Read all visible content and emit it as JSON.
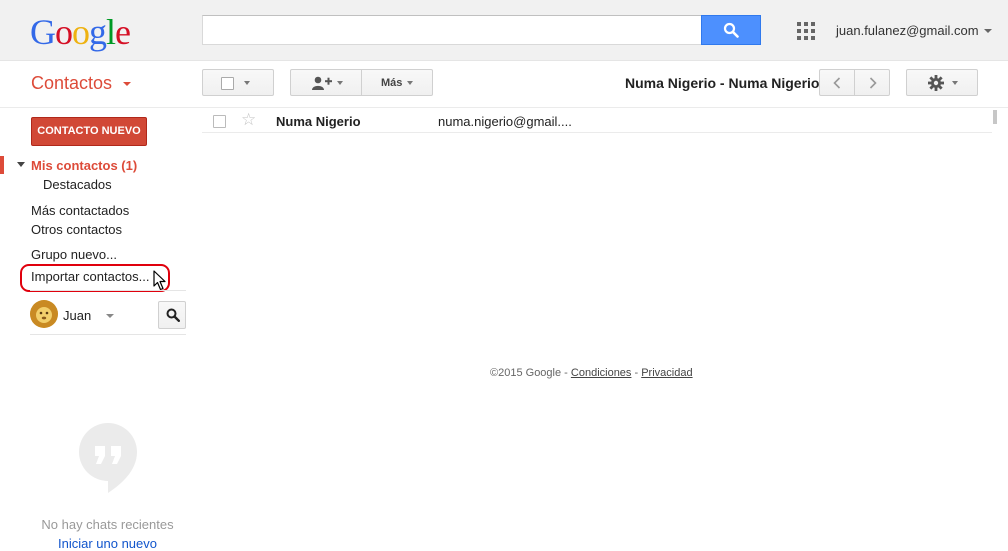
{
  "header": {
    "logo_letters": [
      {
        "ch": "G",
        "color": "#3369e8"
      },
      {
        "ch": "o",
        "color": "#d50f25"
      },
      {
        "ch": "o",
        "color": "#eeb211"
      },
      {
        "ch": "g",
        "color": "#3369e8"
      },
      {
        "ch": "l",
        "color": "#009925"
      },
      {
        "ch": "e",
        "color": "#d50f25"
      }
    ],
    "search_value": "",
    "search_icon": "search-icon",
    "apps_icon": "apps-grid-icon",
    "account_email": "juan.fulanez@gmail.com"
  },
  "toolbar": {
    "app_title": "Contactos",
    "more_label": "Más",
    "page_title": "Numa Nigerio - Numa Nigerio",
    "add_to_group_icon": "add-person-icon",
    "prev_icon": "chevron-left-icon",
    "next_icon": "chevron-right-icon",
    "settings_icon": "gear-icon"
  },
  "sidebar": {
    "new_contact_label": "CONTACTO NUEVO",
    "my_contacts": "Mis contactos (1)",
    "starred": "Destacados",
    "most_contacted": "Más contactados",
    "other_contacts": "Otros contactos",
    "new_group": "Grupo nuevo...",
    "import_contacts": "Importar contactos..."
  },
  "chat": {
    "user_name": "Juan",
    "no_chats": "No hay chats recientes",
    "start_chat": "Iniciar uno nuevo",
    "hangouts_icon": "hangouts-quote-icon"
  },
  "contacts": [
    {
      "name": "Numa Nigerio",
      "email": "numa.nigerio@gmail....",
      "starred": false
    }
  ],
  "footer": {
    "copyright": "©2015 Google",
    "separator": " - ",
    "terms": "Condiciones",
    "privacy": "Privacidad"
  },
  "colors": {
    "accent_red": "#dd4b39",
    "button_red": "#d14836",
    "blue_button": "#4d90fe",
    "link_blue": "#1155cc",
    "highlight_outline": "#e0000d"
  }
}
